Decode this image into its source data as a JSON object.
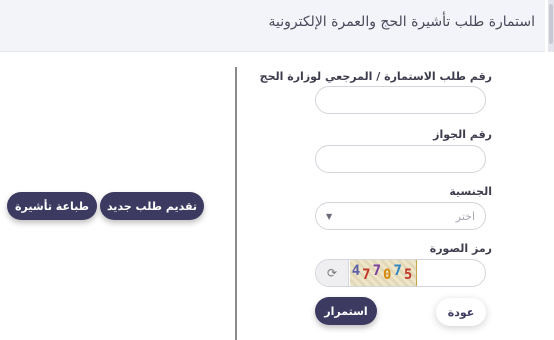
{
  "header": {
    "title": "استمارة طلب تأشيرة الحج والعمرة الإلكترونية"
  },
  "form": {
    "application_label": "رقم طلب الاستمارة / المرجعي لوزارة الحج",
    "application_value": "",
    "passport_label": "رقم الجواز",
    "passport_value": "",
    "nationality_label": "الجنسية",
    "nationality_placeholder": "اختر",
    "captcha_label": "رمز الصورة",
    "captcha_code": "477075",
    "captcha_value": "",
    "back_label": "عودة",
    "continue_label": "استمرار"
  },
  "actions": {
    "new_request_label": "تقديم طلب جديد",
    "print_visa_label": "طباعة تأشيرة"
  },
  "colors": {
    "primary": "#3d3a61",
    "header_bg": "#f3f3fa"
  }
}
